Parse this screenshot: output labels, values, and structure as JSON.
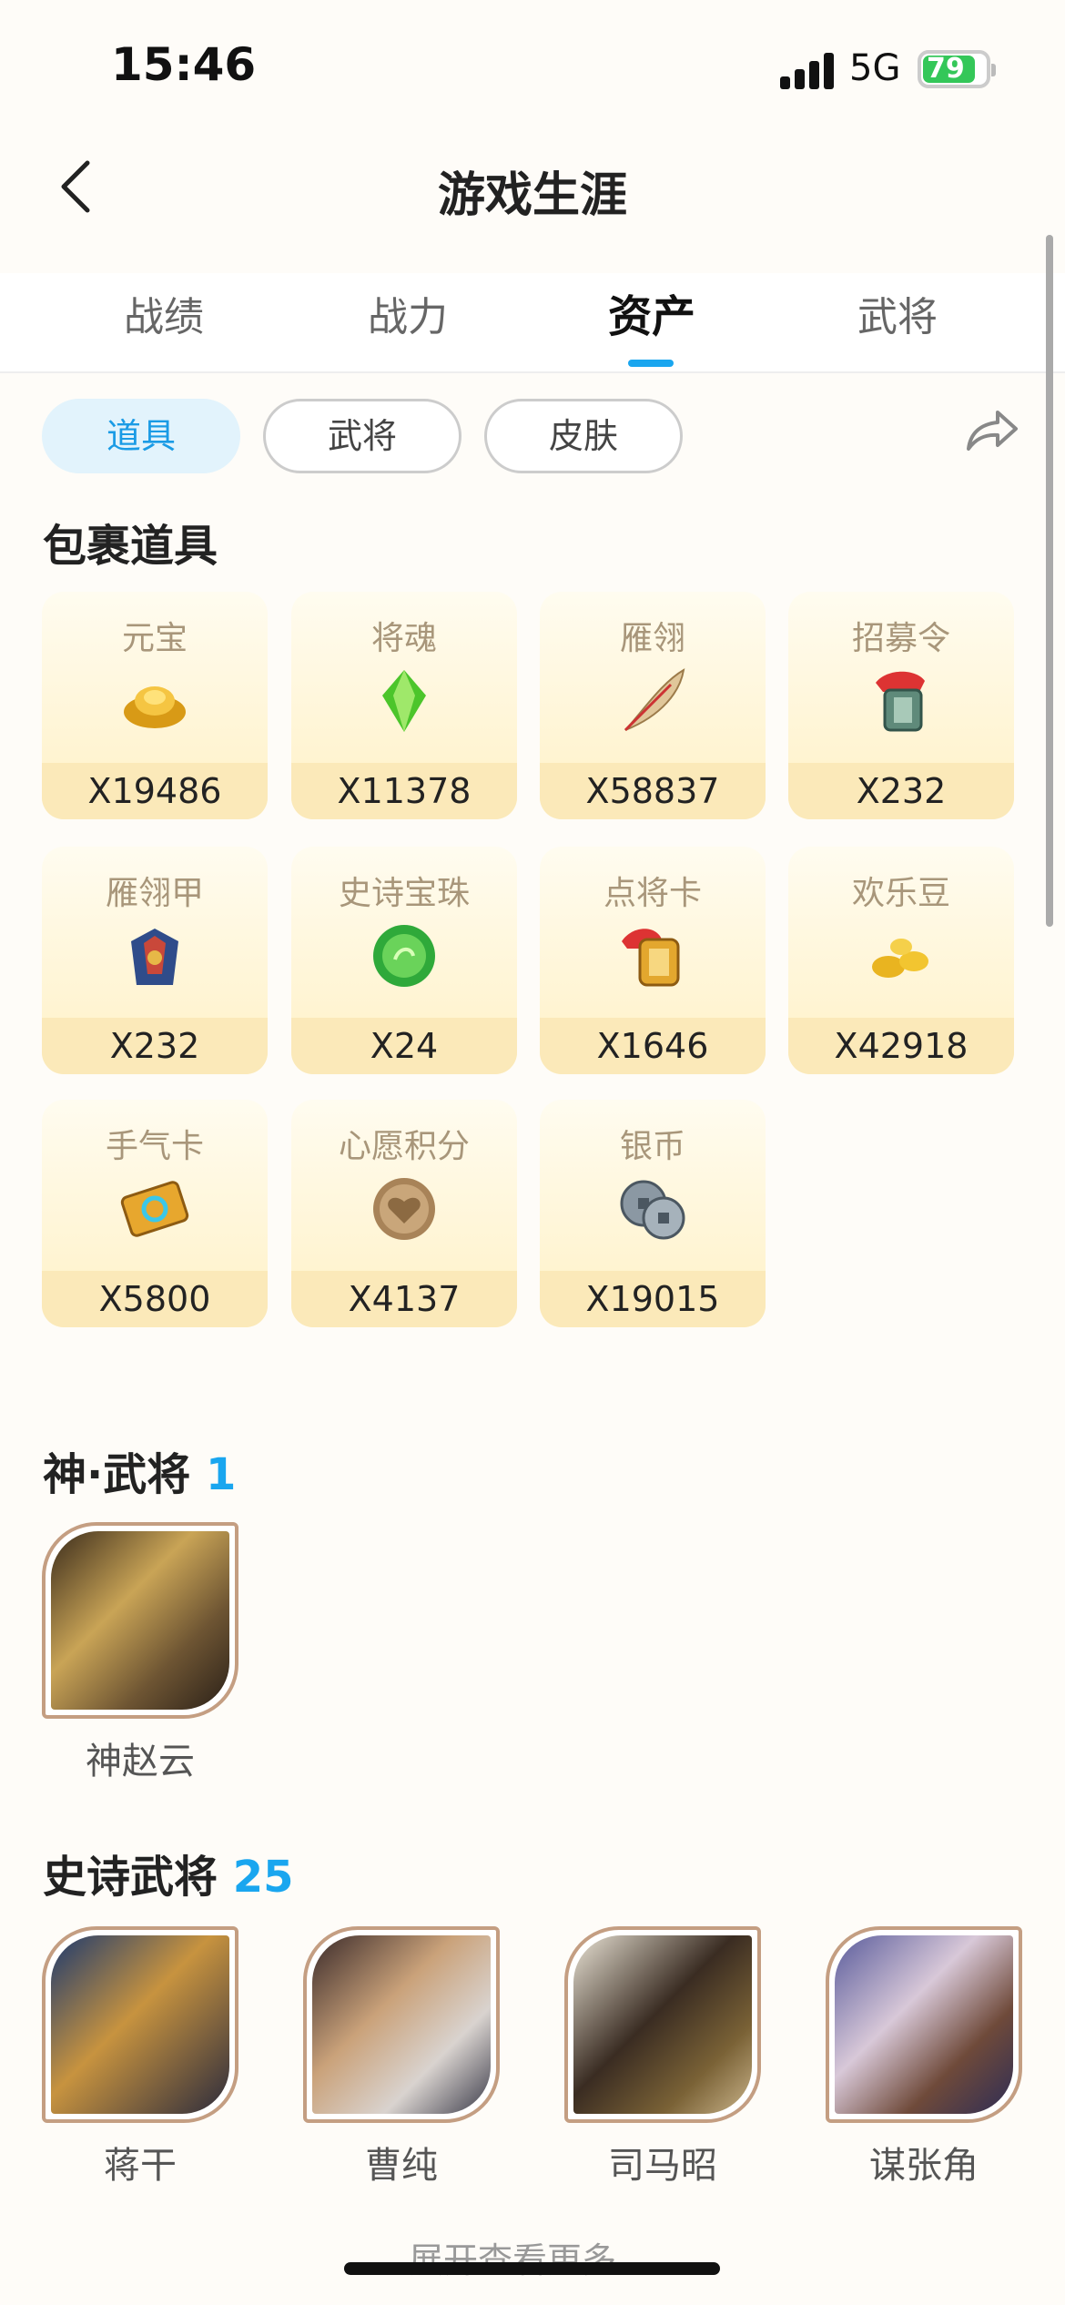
{
  "status_bar": {
    "time": "15:46",
    "network": "5G",
    "battery": "79"
  },
  "header": {
    "title": "游戏生涯"
  },
  "tabs": [
    {
      "label": "战绩",
      "active": false
    },
    {
      "label": "战力",
      "active": false
    },
    {
      "label": "资产",
      "active": true
    },
    {
      "label": "武将",
      "active": false
    }
  ],
  "sub_tabs": [
    {
      "label": "道具",
      "active": true
    },
    {
      "label": "武将",
      "active": false
    },
    {
      "label": "皮肤",
      "active": false
    }
  ],
  "bag": {
    "title": "包裹道具",
    "items": [
      {
        "name": "元宝",
        "qty": "X19486",
        "icon": "gold-ingot-icon"
      },
      {
        "name": "将魂",
        "qty": "X11378",
        "icon": "green-crystal-icon"
      },
      {
        "name": "雁翎",
        "qty": "X58837",
        "icon": "feather-icon"
      },
      {
        "name": "招募令",
        "qty": "X232",
        "icon": "recruit-token-icon"
      },
      {
        "name": "雁翎甲",
        "qty": "X232",
        "icon": "armor-icon"
      },
      {
        "name": "史诗宝珠",
        "qty": "X24",
        "icon": "green-orb-icon"
      },
      {
        "name": "点将卡",
        "qty": "X1646",
        "icon": "general-card-icon"
      },
      {
        "name": "欢乐豆",
        "qty": "X42918",
        "icon": "beans-icon"
      },
      {
        "name": "手气卡",
        "qty": "X5800",
        "icon": "luck-card-icon"
      },
      {
        "name": "心愿积分",
        "qty": "X4137",
        "icon": "heart-coin-icon"
      },
      {
        "name": "银币",
        "qty": "X19015",
        "icon": "silver-coin-icon"
      }
    ]
  },
  "god_generals": {
    "title": "神·武将",
    "count": "1",
    "heroes": [
      {
        "name": "神赵云"
      }
    ]
  },
  "epic_generals": {
    "title": "史诗武将",
    "count": "25",
    "heroes": [
      {
        "name": "蒋干"
      },
      {
        "name": "曹纯"
      },
      {
        "name": "司马昭"
      },
      {
        "name": "谋张角"
      }
    ]
  },
  "expand_more": "展开查看更多"
}
